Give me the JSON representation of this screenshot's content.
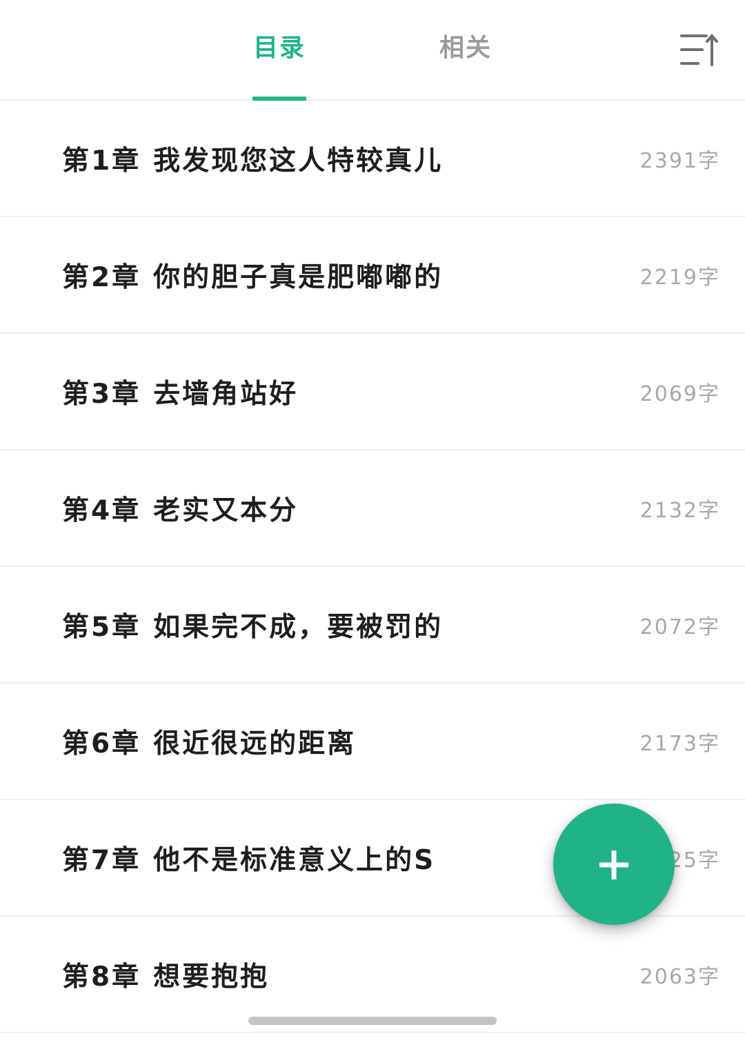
{
  "tabs": [
    {
      "label": "目录",
      "active": true
    },
    {
      "label": "相关",
      "active": false
    }
  ],
  "icons": {
    "sort": "sort-order-icon",
    "fab": "plus-icon"
  },
  "colors": {
    "accent": "#1eb487",
    "fab": "#20b388",
    "inactive_tab": "#9a9a9a",
    "count_text": "#a8a8a8"
  },
  "chapters": [
    {
      "number": "第1章",
      "title": "我发现您这人特较真儿",
      "count": "2391字"
    },
    {
      "number": "第2章",
      "title": "你的胆子真是肥嘟嘟的",
      "count": "2219字"
    },
    {
      "number": "第3章",
      "title": "去墙角站好",
      "count": "2069字"
    },
    {
      "number": "第4章",
      "title": "老实又本分",
      "count": "2132字"
    },
    {
      "number": "第5章",
      "title": "如果完不成，要被罚的",
      "count": "2072字"
    },
    {
      "number": "第6章",
      "title": "很近很远的距离",
      "count": "2173字"
    },
    {
      "number": "第7章",
      "title": "他不是标准意义上的S",
      "count": "25字"
    },
    {
      "number": "第8章",
      "title": "想要抱抱",
      "count": "2063字"
    }
  ]
}
